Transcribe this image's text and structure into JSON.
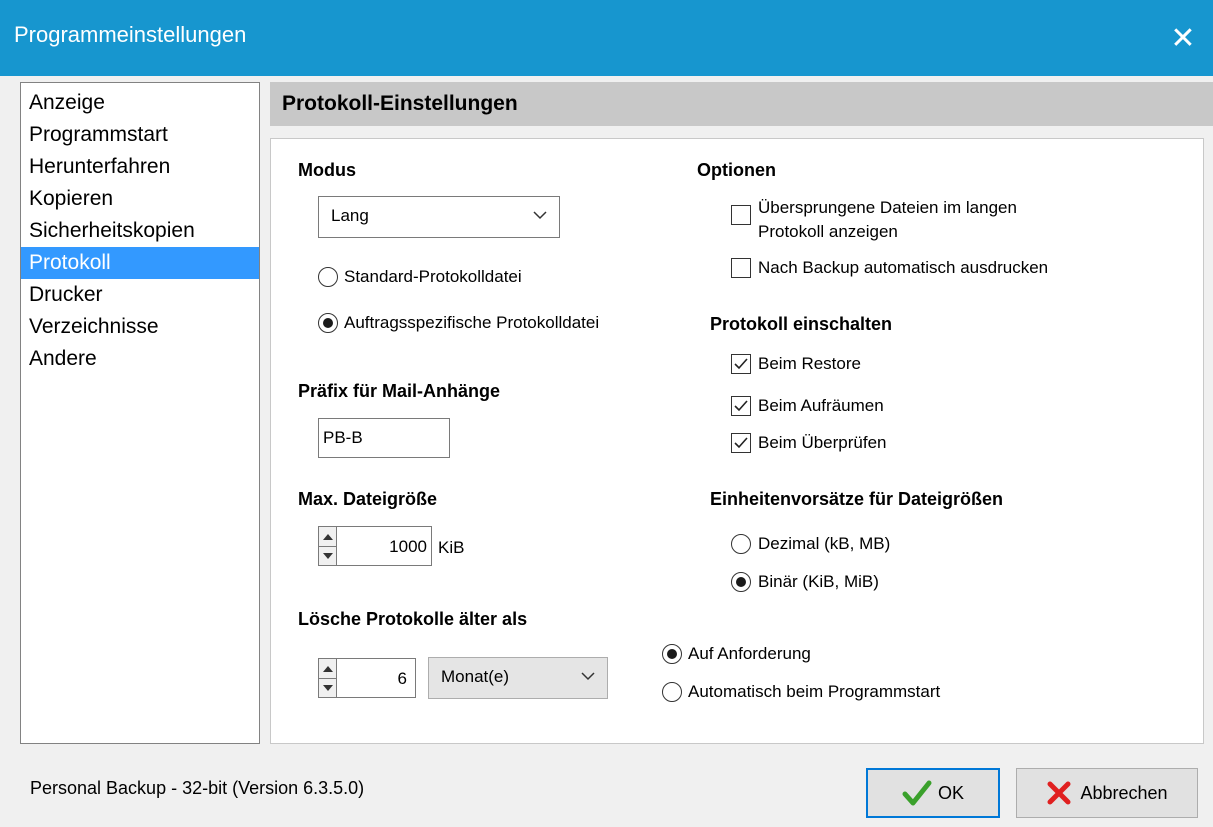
{
  "window": {
    "title": "Programmeinstellungen"
  },
  "icons": {
    "close": "close-icon",
    "ok": "check-icon",
    "cancel": "x-icon",
    "dropdown": "chevron-down-icon"
  },
  "colors": {
    "titlebar": "#1796cf",
    "selection": "#3399ff",
    "header": "#c8c8c8",
    "default_button_border": "#0078d7"
  },
  "sidebar": {
    "items": [
      {
        "label": "Anzeige"
      },
      {
        "label": "Programmstart"
      },
      {
        "label": "Herunterfahren"
      },
      {
        "label": "Kopieren"
      },
      {
        "label": "Sicherheitskopien"
      },
      {
        "label": "Protokoll",
        "selected": true
      },
      {
        "label": "Drucker"
      },
      {
        "label": "Verzeichnisse"
      },
      {
        "label": "Andere"
      }
    ]
  },
  "page": {
    "title": "Protokoll-Einstellungen",
    "modus": {
      "label": "Modus",
      "selected": "Lang",
      "radio_standard": "Standard-Protokolldatei",
      "radio_auftrag": "Auftragsspezifische Protokolldatei"
    },
    "prefix": {
      "label": "Präfix für Mail-Anhänge",
      "value": "PB-B"
    },
    "maxsize": {
      "label": "Max. Dateigröße",
      "value": "1000",
      "unit": "KiB"
    },
    "delete": {
      "label": "Lösche Protokolle älter als",
      "value": "6",
      "unit": "Monat(e)",
      "radio_request": "Auf Anforderung",
      "radio_auto": "Automatisch beim Programmstart"
    },
    "options": {
      "label": "Optionen",
      "skipped_line1": "Übersprungene Dateien im langen",
      "skipped_line2": "Protokoll anzeigen",
      "print": "Nach Backup automatisch ausdrucken"
    },
    "enable": {
      "label": "Protokoll einschalten",
      "restore": "Beim Restore",
      "cleanup": "Beim Aufräumen",
      "verify": "Beim Überprüfen"
    },
    "units": {
      "label": "Einheitenvorsätze für Dateigrößen",
      "decimal": "Dezimal (kB, MB)",
      "binary": "Binär (KiB, MiB)"
    }
  },
  "footer": {
    "version": "Personal Backup - 32-bit (Version 6.3.5.0)",
    "ok_label": "OK",
    "cancel_label": "Abbrechen"
  }
}
